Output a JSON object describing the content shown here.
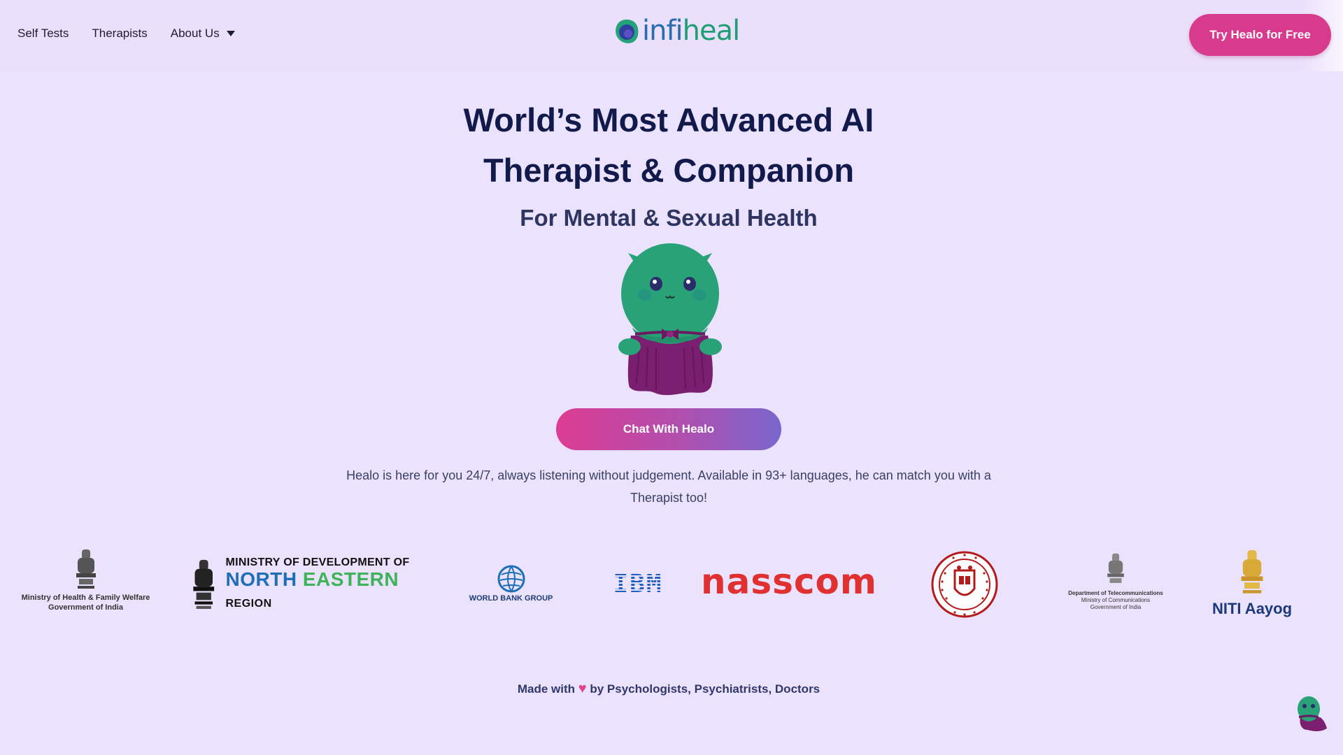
{
  "nav": {
    "links": [
      {
        "label": "Self Tests"
      },
      {
        "label": "Therapists"
      },
      {
        "label": "About Us"
      }
    ],
    "logo_text_main": "infi",
    "logo_text_tail": "heal",
    "cta_label": "Try Healo for Free"
  },
  "hero": {
    "headline_line1": "World’s Most Advanced AI",
    "headline_line2": "Therapist & Companion",
    "subhead": "For Mental & Sexual Health",
    "chat_button_label": "Chat With Healo",
    "description": "Healo is here for you 24/7, always listening without judgement. Available in 93+ languages, he can match you with a Therapist too!"
  },
  "partners": {
    "mohfw_line1": "Ministry of Health & Family Welfare",
    "mohfw_line2": "Government of India",
    "mdoner_top": "MINISTRY OF DEVELOPMENT OF",
    "mdoner_north": "NORTH",
    "mdoner_eastern": "EASTERN",
    "mdoner_region": "REGION",
    "wbg": "WORLD BANK GROUP",
    "ibm": "IBM",
    "nasscom": "nasscom",
    "dot_line1": "Department of Telecommunications",
    "dot_line2": "Ministry of Communications",
    "dot_line3": "Government of India",
    "niti": "NITI Aayog"
  },
  "footer": {
    "made_with_prefix": "Made with",
    "made_with_suffix": "by Psychologists, Psychiatrists, Doctors"
  },
  "colors": {
    "background": "#ebe2fd",
    "cta_pink": "#d83b8e",
    "navy_text": "#111a4a",
    "mascot_green": "#2aa277",
    "mascot_purple": "#7a1f6f"
  },
  "icons": [
    "chevron-down-icon",
    "infiheal-logo-icon",
    "healo-mascot",
    "heart-icon",
    "emblem-icon",
    "globe-icon",
    "cornell-seal-icon"
  ]
}
